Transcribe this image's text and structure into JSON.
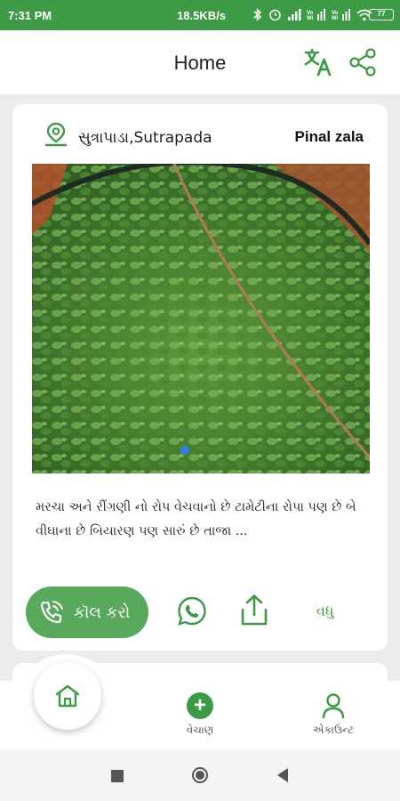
{
  "status_bar": {
    "time": "7:31 PM",
    "network_speed": "18.5KB/s",
    "battery": "77"
  },
  "header": {
    "title": "Home"
  },
  "post": {
    "location": "સુત્રાપાડા,Sutrapada",
    "user_name": "Pinal zala",
    "description": "મરચા અને રીંગણી નો રોપ વેચવાનો છે ટામેટીના રોપા પણ છે બે વીઘાના છે બિયારણ પણ સારું છે તાજા ...",
    "call_label": "કૉલ કરો",
    "more_label": "વધુ"
  },
  "bottom_nav": {
    "items": [
      {
        "label": "",
        "icon": "home-icon"
      },
      {
        "label": "વેચાણ",
        "icon": "plus-circle-icon"
      },
      {
        "label": "એકાઉન્ટ",
        "icon": "person-icon"
      }
    ]
  },
  "colors": {
    "brand_green": "#3d9b46",
    "call_button": "#58a95c",
    "background": "#ececec"
  }
}
